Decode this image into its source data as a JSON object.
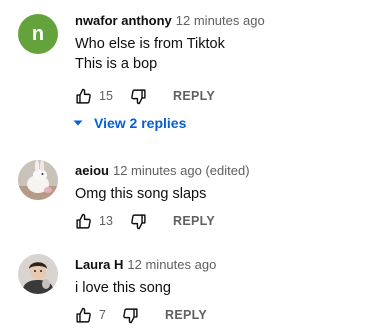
{
  "comments": [
    {
      "avatar_letter": "n",
      "avatar_color": "#64a33c",
      "author": "nwafor anthony",
      "time": "12 minutes ago",
      "lines": [
        "Who else is from Tiktok",
        "This is a bop"
      ],
      "likes": "15",
      "reply_label": "REPLY",
      "replies_toggle": "View 2 replies"
    },
    {
      "author": "aeiou",
      "time": "12 minutes ago (edited)",
      "lines": [
        "Omg this song slaps"
      ],
      "likes": "13",
      "reply_label": "REPLY"
    },
    {
      "author": "Laura H",
      "time": "12 minutes ago",
      "lines": [
        "i love this song"
      ],
      "likes": "7",
      "reply_label": "REPLY"
    }
  ],
  "icons": {
    "like": "thumbs-up-icon",
    "dislike": "thumbs-down-icon",
    "expand": "chevron-down-icon"
  },
  "colors": {
    "link_blue": "#065fd4",
    "meta_gray": "#606060"
  }
}
